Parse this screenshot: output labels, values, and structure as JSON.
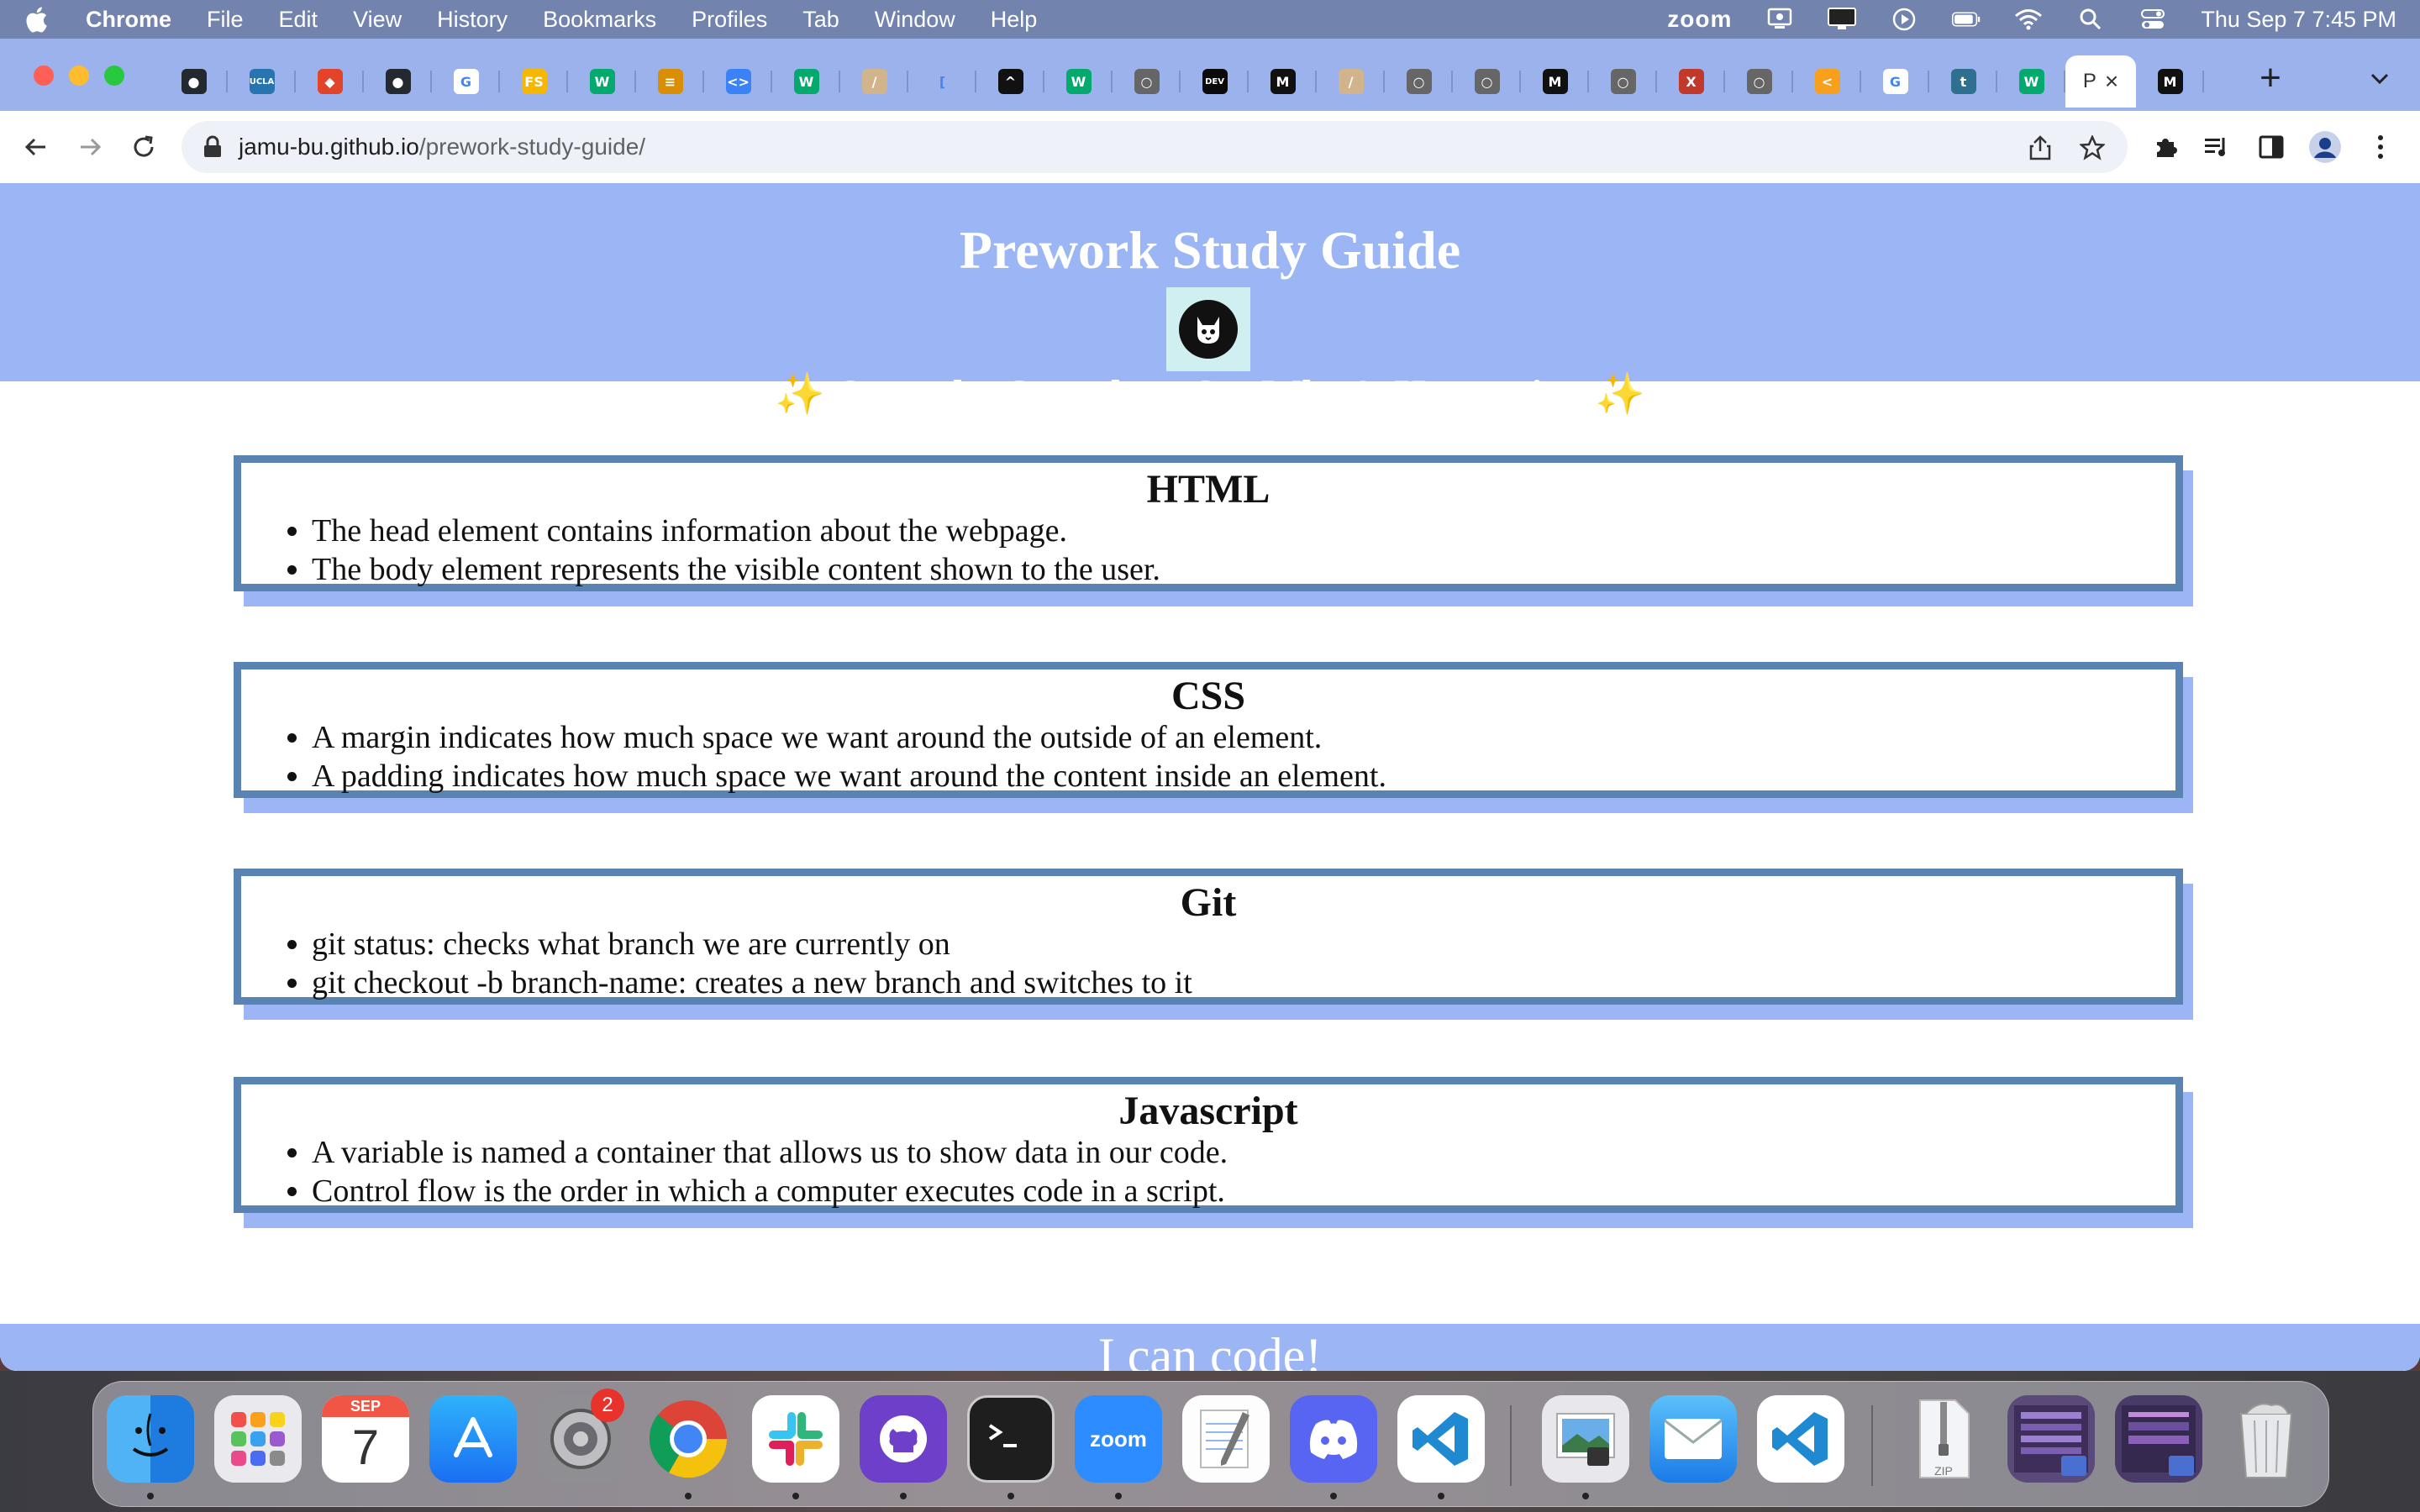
{
  "menubar": {
    "app_name": "Chrome",
    "items": [
      "File",
      "Edit",
      "View",
      "History",
      "Bookmarks",
      "Profiles",
      "Tab",
      "Window",
      "Help"
    ],
    "status_zoom": "zoom",
    "clock": "Thu Sep 7  7:45 PM"
  },
  "browser": {
    "active_tab_text": "P",
    "url_host": "jamu-bu.github.io",
    "url_path": "/prework-study-guide/",
    "tab_favicons": [
      {
        "name": "github-icon",
        "bg": "#24292f",
        "glyph": "●",
        "after": "j"
      },
      {
        "name": "ucla-icon",
        "bg": "#2774ae",
        "glyph": "UCLA",
        "after": ""
      },
      {
        "name": "gitlab-icon",
        "bg": "#e24329",
        "glyph": "◆",
        "after": ""
      },
      {
        "name": "github-icon",
        "bg": "#24292f",
        "glyph": "●",
        "after": ""
      },
      {
        "name": "google-icon",
        "bg": "#ffffff",
        "glyph": "G",
        "after": ""
      },
      {
        "name": "fs-icon",
        "bg": "#f5b700",
        "glyph": "FS",
        "after": ""
      },
      {
        "name": "w3schools-icon",
        "bg": "#04aa6d",
        "glyph": "W",
        "after": ""
      },
      {
        "name": "books-icon",
        "bg": "#d98e04",
        "glyph": "≡",
        "after": ""
      },
      {
        "name": "code-icon",
        "bg": "#3b82f6",
        "glyph": "<>",
        "after": ""
      },
      {
        "name": "w3schools-icon",
        "bg": "#04aa6d",
        "glyph": "W",
        "after": ""
      },
      {
        "name": "feather-icon",
        "bg": "#d2b48c",
        "glyph": "/",
        "after": ""
      },
      {
        "name": "audio-icon",
        "bg": "#9cb2ec",
        "glyph": "[",
        "after": ""
      },
      {
        "name": "codepen-icon",
        "bg": "#111111",
        "glyph": "^",
        "after": ""
      },
      {
        "name": "w3schools-icon",
        "bg": "#04aa6d",
        "glyph": "W",
        "after": ""
      },
      {
        "name": "globe-icon",
        "bg": "#666666",
        "glyph": "○",
        "after": ""
      },
      {
        "name": "dev-icon",
        "bg": "#0a0a0a",
        "glyph": "DEV",
        "after": ""
      },
      {
        "name": "medium-icon",
        "bg": "#111111",
        "glyph": "M",
        "after": ""
      },
      {
        "name": "feather-icon",
        "bg": "#d2b48c",
        "glyph": "/",
        "after": "j"
      },
      {
        "name": "globe-icon",
        "bg": "#666666",
        "glyph": "○",
        "after": ""
      },
      {
        "name": "globe-icon",
        "bg": "#666666",
        "glyph": "○",
        "after": ""
      },
      {
        "name": "medium-icon",
        "bg": "#111111",
        "glyph": "M",
        "after": ""
      },
      {
        "name": "globe-icon",
        "bg": "#666666",
        "glyph": "○",
        "after": ""
      },
      {
        "name": "figure-icon",
        "bg": "#c0392b",
        "glyph": "X",
        "after": ""
      },
      {
        "name": "globe-icon",
        "bg": "#666666",
        "glyph": "○",
        "after": ""
      },
      {
        "name": "leetcode-icon",
        "bg": "#f89f1b",
        "glyph": "<",
        "after": ""
      },
      {
        "name": "google-icon",
        "bg": "#ffffff",
        "glyph": "G",
        "after": ""
      },
      {
        "name": "bird-icon",
        "bg": "#2f6f8f",
        "glyph": "t",
        "after": ""
      },
      {
        "name": "w3schools-icon",
        "bg": "#04aa6d",
        "glyph": "W",
        "after": ""
      }
    ],
    "after_active_favicon": {
      "name": "medium-icon",
      "bg": "#111111",
      "glyph": "M"
    }
  },
  "page": {
    "title": "Prework Study Guide",
    "subtitle": "Open the Console to See What's Happening",
    "sparkle": "✨",
    "sections": [
      {
        "heading": "HTML",
        "items": [
          "The head element contains information about the webpage.",
          "The body element represents the visible content shown to the user."
        ]
      },
      {
        "heading": "CSS",
        "items": [
          "A margin indicates how much space we want around the outside of an element.",
          "A padding indicates how much space we want around the content inside an element."
        ]
      },
      {
        "heading": "Git",
        "items": [
          "git status: checks what branch we are currently on",
          "git checkout -b branch-name: creates a new branch and switches to it"
        ]
      },
      {
        "heading": "Javascript",
        "items": [
          "A variable is named a container that allows us to show data in our code.",
          "Control flow is the order in which a computer executes code in a script."
        ]
      }
    ],
    "footer": "I can code!"
  },
  "dock": {
    "calendar_month": "SEP",
    "calendar_day": "7",
    "settings_badge": "2",
    "zoom_label": "zoom",
    "zip_label": "ZIP",
    "apps": [
      "finder-icon",
      "launchpad-icon",
      "calendar-icon",
      "app-store-icon",
      "system-settings-icon",
      "chrome-icon",
      "slack-icon",
      "github-desktop-icon",
      "terminal-icon",
      "zoom-icon",
      "textedit-icon",
      "discord-icon",
      "vscode-icon",
      "preview-icon",
      "mail-icon",
      "vscode-icon",
      "zip-file-icon",
      "screenshot-thumb-icon",
      "screenshot-thumb-icon",
      "trash-icon"
    ]
  }
}
